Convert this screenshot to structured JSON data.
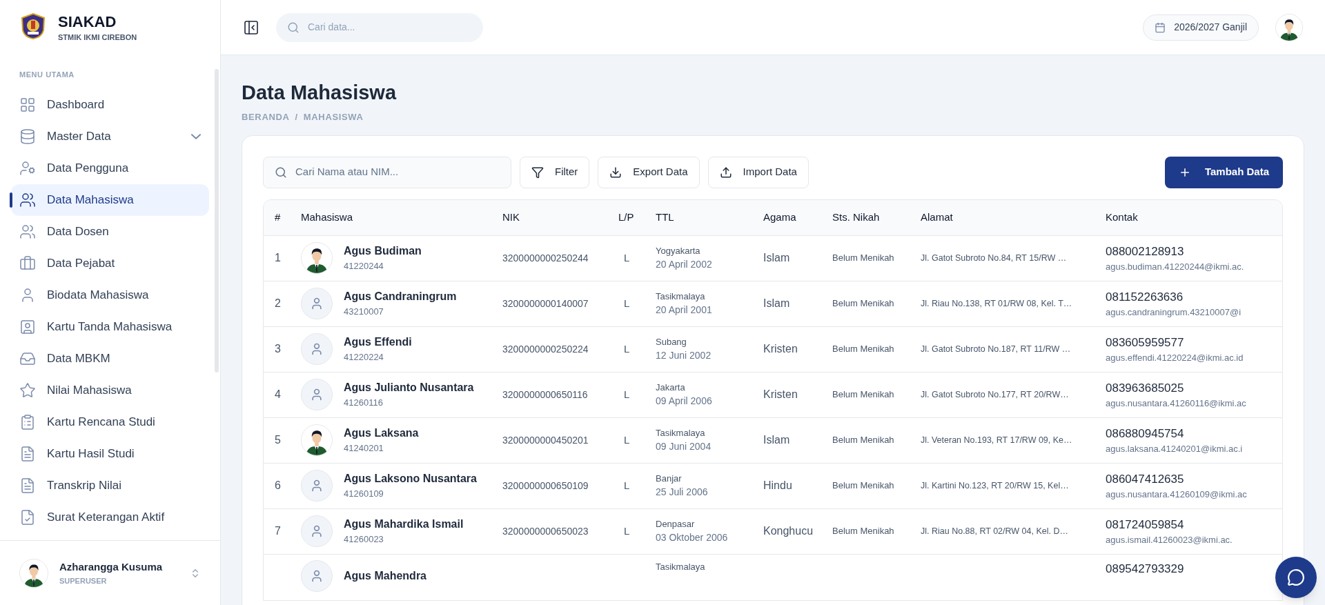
{
  "brand": {
    "title": "SIAKAD",
    "subtitle": "STMIK IKMI CIREBON"
  },
  "sidebar": {
    "section": "MENU UTAMA",
    "items": [
      {
        "label": "Dashboard",
        "selected": false
      },
      {
        "label": "Master Data",
        "selected": false,
        "expanded": false
      },
      {
        "label": "Data Pengguna",
        "selected": false
      },
      {
        "label": "Data Mahasiswa",
        "selected": true
      },
      {
        "label": "Data Dosen",
        "selected": false
      },
      {
        "label": "Data Pejabat",
        "selected": false
      },
      {
        "label": "Biodata Mahasiswa",
        "selected": false
      },
      {
        "label": "Kartu Tanda Mahasiswa",
        "selected": false
      },
      {
        "label": "Data MBKM",
        "selected": false
      },
      {
        "label": "Nilai Mahasiswa",
        "selected": false
      },
      {
        "label": "Kartu Rencana Studi",
        "selected": false
      },
      {
        "label": "Kartu Hasil Studi",
        "selected": false
      },
      {
        "label": "Transkrip Nilai",
        "selected": false
      },
      {
        "label": "Surat Keterangan Aktif",
        "selected": false
      }
    ]
  },
  "user": {
    "name": "Azharangga Kusuma",
    "role": "SUPERUSER"
  },
  "header": {
    "search_placeholder": "Cari data...",
    "period": "2026/2027 Ganjil"
  },
  "page": {
    "title": "Data Mahasiswa",
    "breadcrumb": [
      "BERANDA",
      "MAHASISWA"
    ],
    "separator": "/"
  },
  "toolbar": {
    "search_placeholder": "Cari Nama atau NIM...",
    "buttons": [
      "Filter",
      "Export Data",
      "Import Data"
    ],
    "primary": "Tambah Data"
  },
  "table": {
    "columns": [
      "#",
      "Mahasiswa",
      "NIK",
      "L/P",
      "TTL",
      "Agama",
      "Sts. Nikah",
      "Alamat",
      "Kontak"
    ],
    "rows": [
      {
        "no": "1",
        "photo": true,
        "name": "Agus Budiman",
        "nim": "41220244",
        "nik": "3200000000250244",
        "lp": "L",
        "place": "Yogyakarta",
        "date": "20 April 2002",
        "agama": "Islam",
        "nikah": "Belum Menikah",
        "alamat": "Jl. Gatot Subroto No.84, RT 15/RW …",
        "phone": "088002128913",
        "email": "agus.budiman.41220244@ikmi.ac."
      },
      {
        "no": "2",
        "photo": false,
        "name": "Agus Candraningrum",
        "nim": "43210007",
        "nik": "3200000000140007",
        "lp": "L",
        "place": "Tasikmalaya",
        "date": "20 April 2001",
        "agama": "Islam",
        "nikah": "Belum Menikah",
        "alamat": "Jl. Riau No.138, RT 01/RW 08, Kel. T…",
        "phone": "081152263636",
        "email": "agus.candraningrum.43210007@i"
      },
      {
        "no": "3",
        "photo": false,
        "name": "Agus Effendi",
        "nim": "41220224",
        "nik": "3200000000250224",
        "lp": "L",
        "place": "Subang",
        "date": "12 Juni 2002",
        "agama": "Kristen",
        "nikah": "Belum Menikah",
        "alamat": "Jl. Gatot Subroto No.187, RT 11/RW …",
        "phone": "083605959577",
        "email": "agus.effendi.41220224@ikmi.ac.id"
      },
      {
        "no": "4",
        "photo": false,
        "name": "Agus Julianto Nusantara",
        "nim": "41260116",
        "nik": "3200000000650116",
        "lp": "L",
        "place": "Jakarta",
        "date": "09 April 2006",
        "agama": "Kristen",
        "nikah": "Belum Menikah",
        "alamat": "Jl. Gatot Subroto No.177, RT 20/RW…",
        "phone": "083963685025",
        "email": "agus.nusantara.41260116@ikmi.ac"
      },
      {
        "no": "5",
        "photo": true,
        "name": "Agus Laksana",
        "nim": "41240201",
        "nik": "3200000000450201",
        "lp": "L",
        "place": "Tasikmalaya",
        "date": "09 Juni 2004",
        "agama": "Islam",
        "nikah": "Belum Menikah",
        "alamat": "Jl. Veteran No.193, RT 17/RW 09, Ke…",
        "phone": "086880945754",
        "email": "agus.laksana.41240201@ikmi.ac.i"
      },
      {
        "no": "6",
        "photo": false,
        "name": "Agus Laksono Nusantara",
        "nim": "41260109",
        "nik": "3200000000650109",
        "lp": "L",
        "place": "Banjar",
        "date": "25 Juli 2006",
        "agama": "Hindu",
        "nikah": "Belum Menikah",
        "alamat": "Jl. Kartini No.123, RT 20/RW 15, Kel…",
        "phone": "086047412635",
        "email": "agus.nusantara.41260109@ikmi.ac"
      },
      {
        "no": "7",
        "photo": false,
        "name": "Agus Mahardika Ismail",
        "nim": "41260023",
        "nik": "3200000000650023",
        "lp": "L",
        "place": "Denpasar",
        "date": "03 Oktober 2006",
        "agama": "Konghucu",
        "nikah": "Belum Menikah",
        "alamat": "Jl. Riau No.88, RT 02/RW 04, Kel. D…",
        "phone": "081724059854",
        "email": "agus.ismail.41260023@ikmi.ac."
      },
      {
        "photo": false,
        "name": "Agus Mahendra",
        "place": "Tasikmalaya",
        "phone": "089542793329"
      }
    ]
  }
}
